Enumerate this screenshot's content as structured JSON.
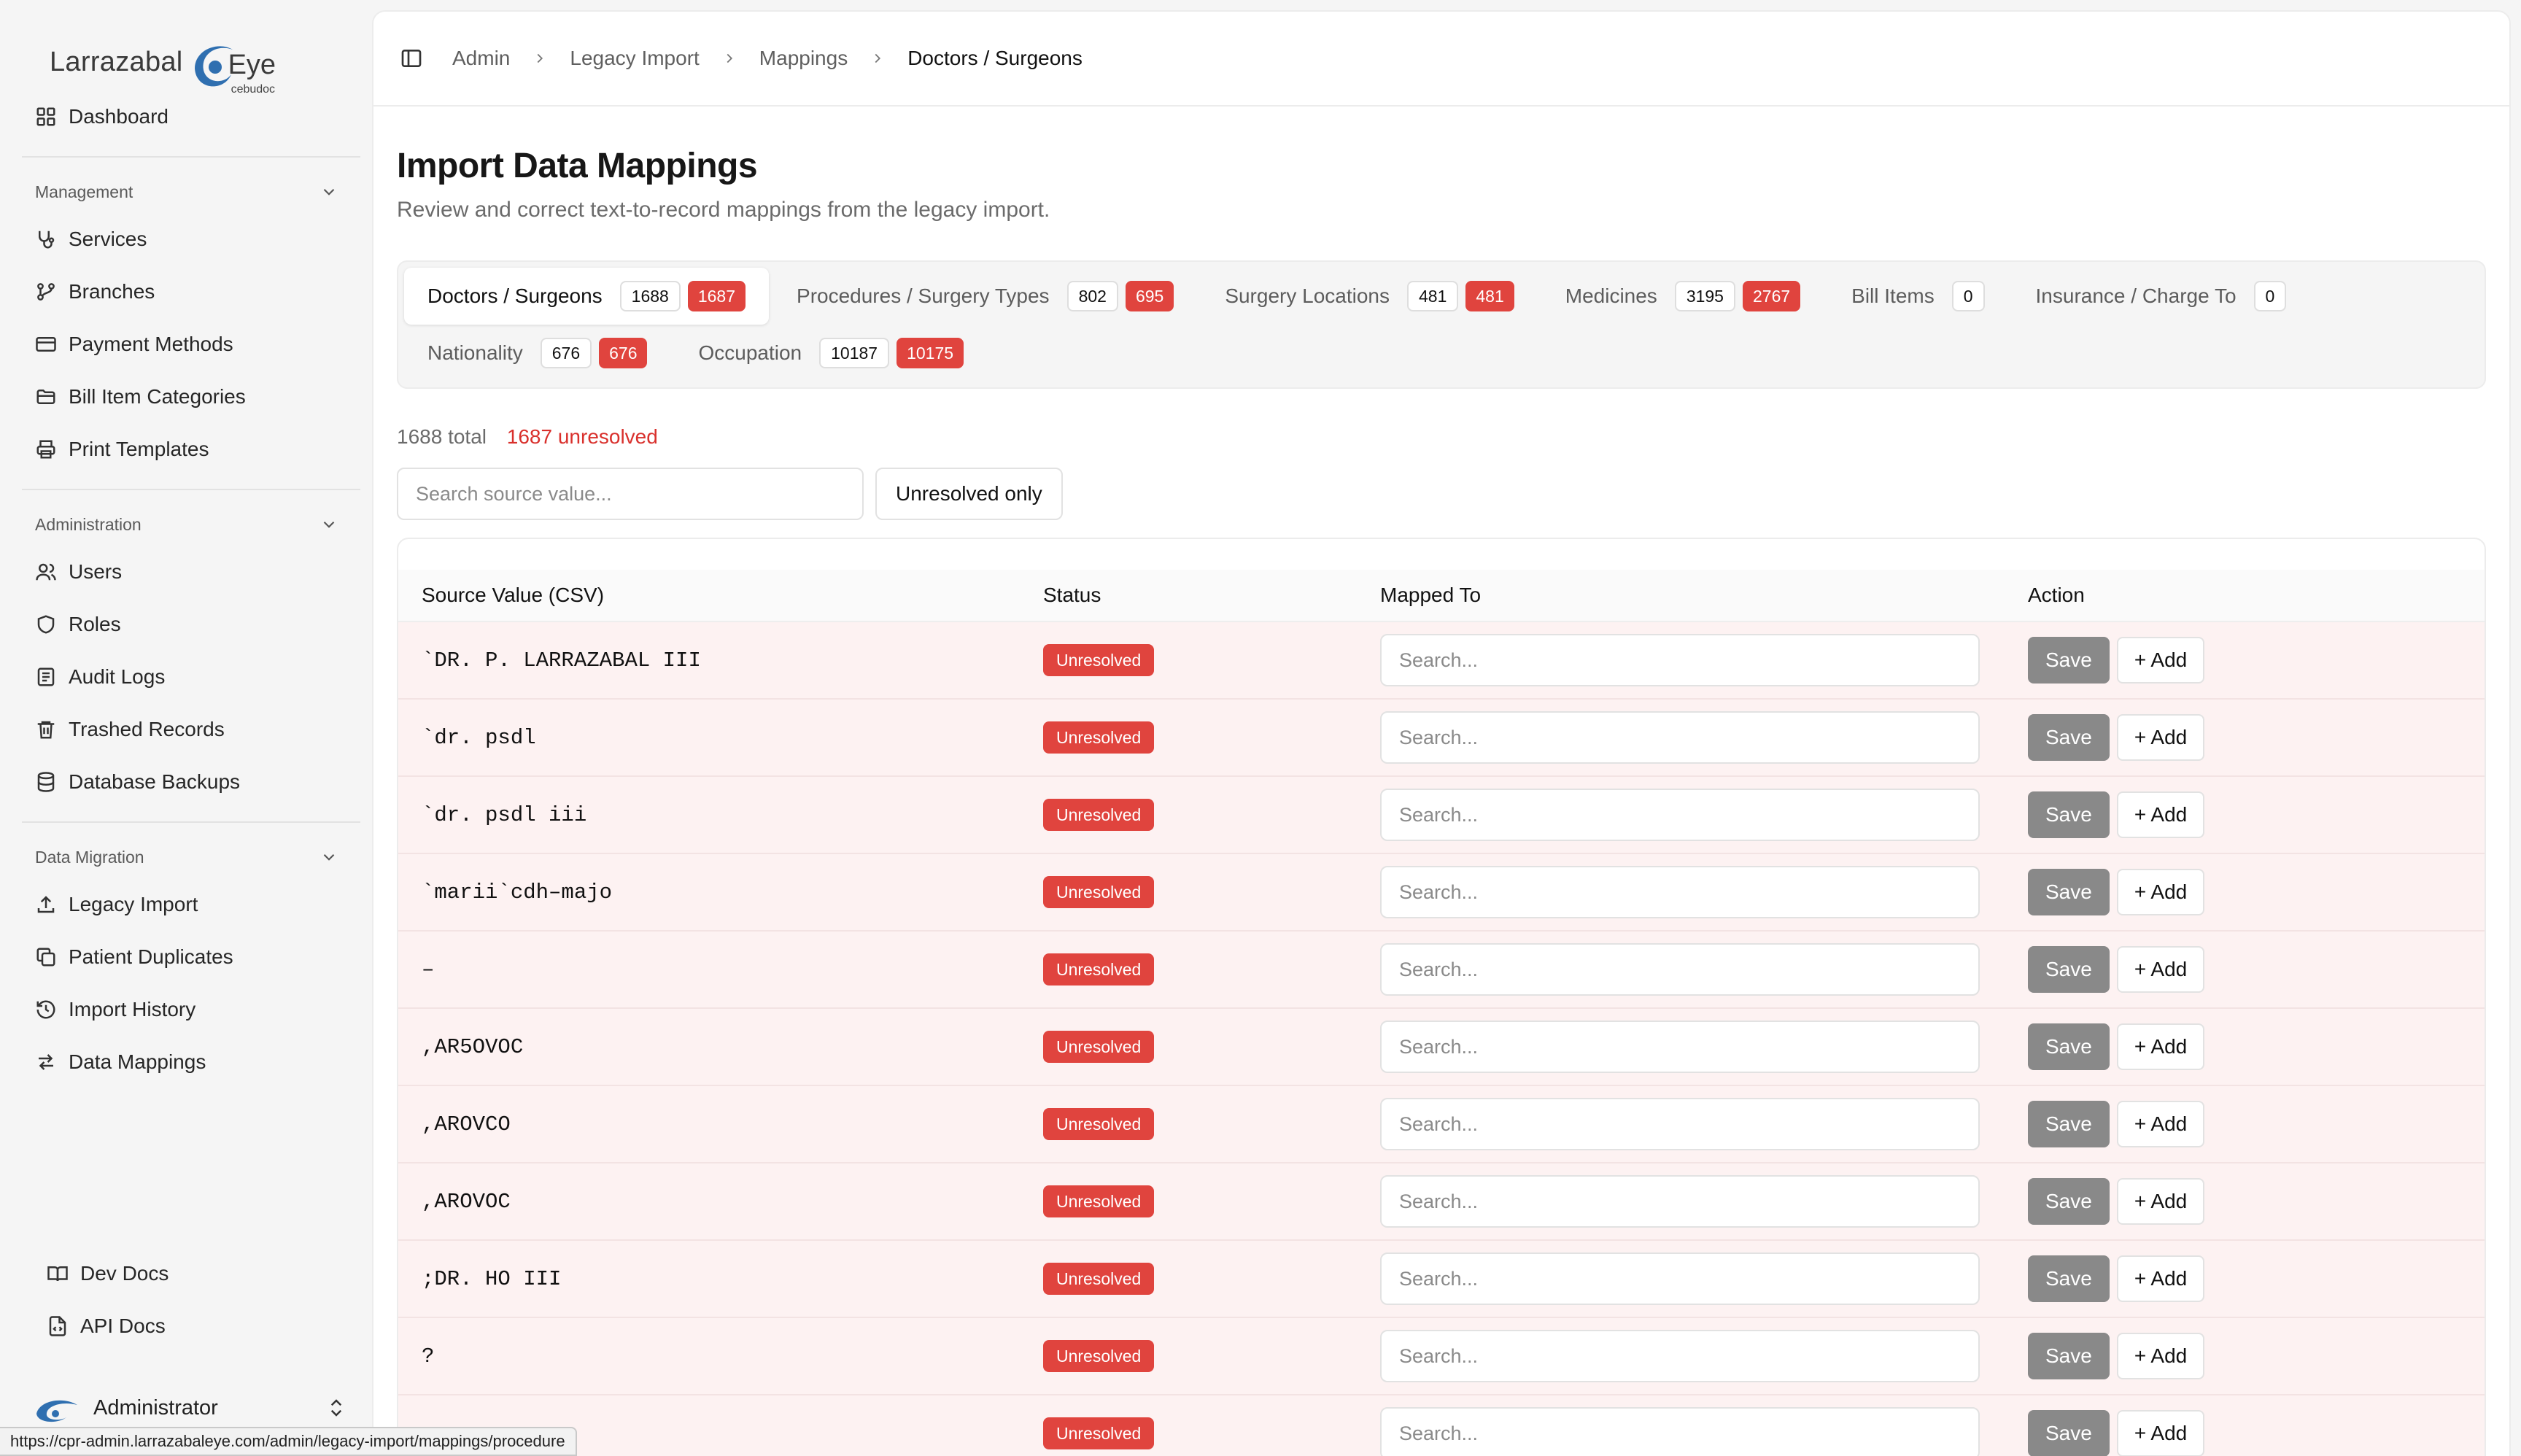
{
  "brand": {
    "name": "Larrazabal",
    "eye_word": "Eye",
    "sub": "cebudoc",
    "accent": "#2f6fb0"
  },
  "sidebar": {
    "dashboard": {
      "label": "Dashboard",
      "icon": "dashboard-icon"
    },
    "groups": [
      {
        "title": "Management",
        "items": [
          {
            "label": "Services",
            "icon": "stethoscope-icon"
          },
          {
            "label": "Branches",
            "icon": "branch-icon"
          },
          {
            "label": "Payment Methods",
            "icon": "credit-card-icon"
          },
          {
            "label": "Bill Item Categories",
            "icon": "folder-icon"
          },
          {
            "label": "Print Templates",
            "icon": "printer-icon"
          }
        ]
      },
      {
        "title": "Administration",
        "items": [
          {
            "label": "Users",
            "icon": "users-icon"
          },
          {
            "label": "Roles",
            "icon": "shield-icon"
          },
          {
            "label": "Audit Logs",
            "icon": "logs-icon"
          },
          {
            "label": "Trashed Records",
            "icon": "trash-icon"
          },
          {
            "label": "Database Backups",
            "icon": "database-icon"
          }
        ]
      },
      {
        "title": "Data Migration",
        "items": [
          {
            "label": "Legacy Import",
            "icon": "upload-icon"
          },
          {
            "label": "Patient Duplicates",
            "icon": "copy-icon"
          },
          {
            "label": "Import History",
            "icon": "history-icon"
          },
          {
            "label": "Data Mappings",
            "icon": "swap-icon"
          }
        ]
      }
    ],
    "bottom": [
      {
        "label": "Dev Docs",
        "icon": "book-icon"
      },
      {
        "label": "API Docs",
        "icon": "file-code-icon"
      }
    ],
    "user": {
      "name": "Administrator"
    }
  },
  "breadcrumb": [
    "Admin",
    "Legacy Import",
    "Mappings",
    "Doctors / Surgeons"
  ],
  "page": {
    "title": "Import Data Mappings",
    "description": "Review and correct text-to-record mappings from the legacy import."
  },
  "tabs": [
    {
      "label": "Doctors / Surgeons",
      "count": "1688",
      "unresolved": "1687",
      "active": true
    },
    {
      "label": "Procedures / Surgery Types",
      "count": "802",
      "unresolved": "695"
    },
    {
      "label": "Surgery Locations",
      "count": "481",
      "unresolved": "481"
    },
    {
      "label": "Medicines",
      "count": "3195",
      "unresolved": "2767"
    },
    {
      "label": "Bill Items",
      "count": "0",
      "unresolved": null
    },
    {
      "label": "Insurance / Charge To",
      "count": "0",
      "unresolved": null
    },
    {
      "label": "Nationality",
      "count": "676",
      "unresolved": "676"
    },
    {
      "label": "Occupation",
      "count": "10187",
      "unresolved": "10175"
    }
  ],
  "stats": {
    "total": "1688 total",
    "unresolved": "1687 unresolved"
  },
  "filters": {
    "search_placeholder": "Search source value...",
    "toggle_label": "Unresolved only"
  },
  "table": {
    "headers": {
      "source": "Source Value (CSV)",
      "status": "Status",
      "mapped": "Mapped To",
      "action": "Action"
    },
    "mapped_placeholder": "Search...",
    "save_label": "Save",
    "add_label": "+ Add",
    "rows": [
      {
        "source": "`DR. P. LARRAZABAL III",
        "status": "Unresolved"
      },
      {
        "source": "`dr. psdl",
        "status": "Unresolved"
      },
      {
        "source": "`dr. psdl iii",
        "status": "Unresolved"
      },
      {
        "source": "`marii`cdh–majo",
        "status": "Unresolved"
      },
      {
        "source": "–",
        "status": "Unresolved"
      },
      {
        "source": ",AR5OVOC",
        "status": "Unresolved"
      },
      {
        "source": ",AROVCO",
        "status": "Unresolved"
      },
      {
        "source": ",AROVOC",
        "status": "Unresolved"
      },
      {
        "source": ";DR. HO III",
        "status": "Unresolved"
      },
      {
        "source": "?",
        "status": "Unresolved"
      },
      {
        "source": "",
        "status": "Unresolved"
      }
    ]
  },
  "status_url": "https://cpr-admin.larrazabaleye.com/admin/legacy-import/mappings/procedure"
}
